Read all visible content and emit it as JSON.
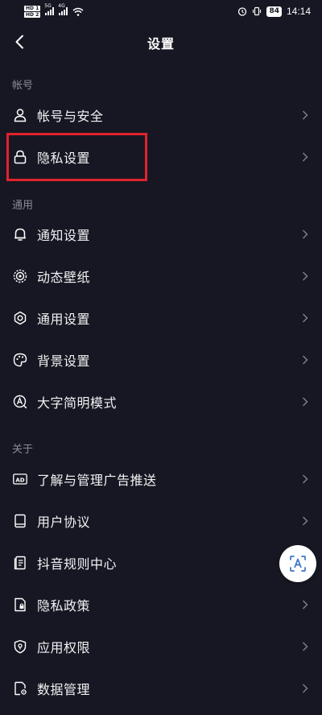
{
  "status_bar": {
    "hd1": "HD 1",
    "hd2": "HD 2",
    "net1": "5G",
    "net2": "4G",
    "battery": "84",
    "time": "14:14"
  },
  "header": {
    "title": "设置"
  },
  "sections": {
    "account": {
      "title": "帐号",
      "items": [
        {
          "label": "帐号与安全",
          "icon": "user-icon"
        },
        {
          "label": "隐私设置",
          "icon": "lock-icon"
        }
      ]
    },
    "general": {
      "title": "通用",
      "items": [
        {
          "label": "通知设置",
          "icon": "bell-icon"
        },
        {
          "label": "动态壁纸",
          "icon": "live-wallpaper-icon"
        },
        {
          "label": "通用设置",
          "icon": "gear-icon"
        },
        {
          "label": "背景设置",
          "icon": "palette-icon"
        },
        {
          "label": "大字简明模式",
          "icon": "large-font-icon"
        }
      ]
    },
    "about": {
      "title": "关于",
      "items": [
        {
          "label": "了解与管理广告推送",
          "icon": "ad-icon",
          "icon_text": "AD"
        },
        {
          "label": "用户协议",
          "icon": "book-icon"
        },
        {
          "label": "抖音规则中心",
          "icon": "rules-document-icon"
        },
        {
          "label": "隐私政策",
          "icon": "privacy-document-icon"
        },
        {
          "label": "应用权限",
          "icon": "shield-icon"
        },
        {
          "label": "数据管理",
          "icon": "data-file-icon"
        }
      ]
    }
  },
  "highlight": {
    "target": "隐私设置",
    "color": "#e0232c"
  },
  "colors": {
    "background": "#161722",
    "text": "#f2f2f4",
    "section_title": "#8a8b95",
    "chevron": "#7d7e88"
  }
}
